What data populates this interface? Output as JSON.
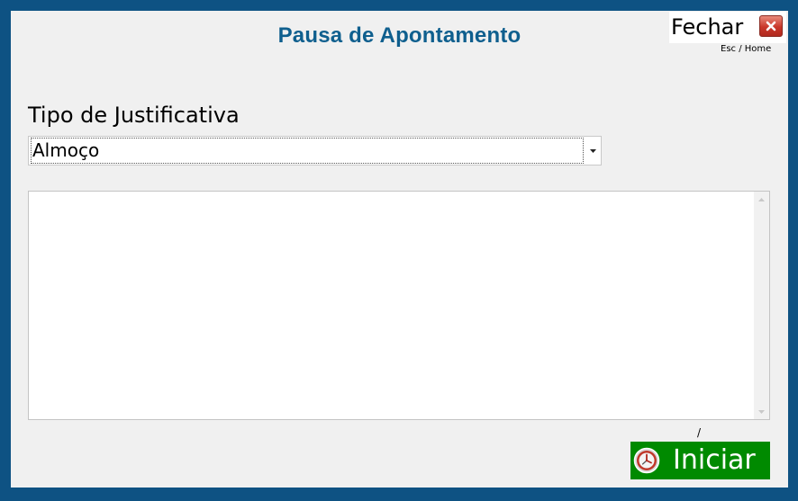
{
  "window": {
    "title": "Pausa de Apontamento"
  },
  "close": {
    "label": "Fechar",
    "hint": "Esc / Home",
    "icon": "close-icon"
  },
  "justification": {
    "label": "Tipo de Justificativa",
    "selected": "Almoço",
    "icon": "chevron-down-icon"
  },
  "notes": {
    "value": ""
  },
  "footer": {
    "marker": "/"
  },
  "start": {
    "label": "Iniciar",
    "icon": "clock-icon"
  },
  "colors": {
    "frame": "#0e5283",
    "title": "#0f5f8e",
    "start_button": "#008a00",
    "close_icon": "#c9372a"
  }
}
